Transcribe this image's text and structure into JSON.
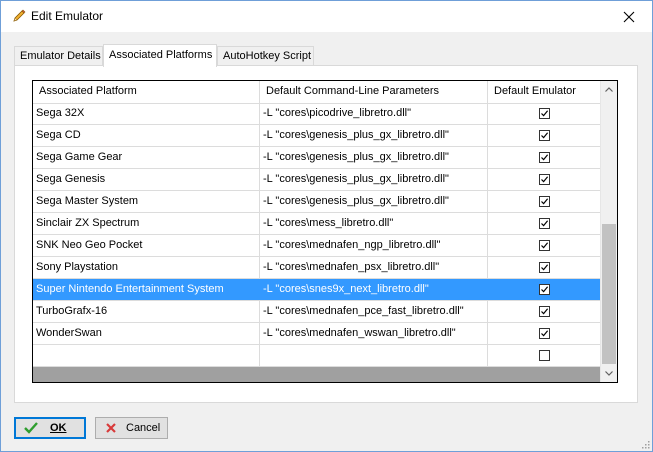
{
  "window": {
    "title": "Edit Emulator"
  },
  "tabs": [
    {
      "label": "Emulator Details"
    },
    {
      "label": "Associated Platforms"
    },
    {
      "label": "AutoHotkey Script"
    }
  ],
  "grid": {
    "columns": [
      "Associated Platform",
      "Default Command-Line Parameters",
      "Default Emulator"
    ],
    "rows": [
      {
        "platform": "Sega 32X",
        "params": "-L \"cores\\picodrive_libretro.dll\"",
        "default": true
      },
      {
        "platform": "Sega CD",
        "params": "-L \"cores\\genesis_plus_gx_libretro.dll\"",
        "default": true
      },
      {
        "platform": "Sega Game Gear",
        "params": "-L \"cores\\genesis_plus_gx_libretro.dll\"",
        "default": true
      },
      {
        "platform": "Sega Genesis",
        "params": "-L \"cores\\genesis_plus_gx_libretro.dll\"",
        "default": true
      },
      {
        "platform": "Sega Master System",
        "params": "-L \"cores\\genesis_plus_gx_libretro.dll\"",
        "default": true
      },
      {
        "platform": "Sinclair ZX Spectrum",
        "params": "-L \"cores\\mess_libretro.dll\"",
        "default": true
      },
      {
        "platform": "SNK Neo Geo Pocket",
        "params": "-L \"cores\\mednafen_ngp_libretro.dll\"",
        "default": true
      },
      {
        "platform": "Sony Playstation",
        "params": "-L \"cores\\mednafen_psx_libretro.dll\"",
        "default": true
      },
      {
        "platform": "Super Nintendo Entertainment System",
        "params": "-L \"cores\\snes9x_next_libretro.dll\"",
        "default": true
      },
      {
        "platform": "TurboGrafx-16",
        "params": "-L \"cores\\mednafen_pce_fast_libretro.dll\"",
        "default": true
      },
      {
        "platform": "WonderSwan",
        "params": "-L \"cores\\mednafen_wswan_libretro.dll\"",
        "default": true
      },
      {
        "platform": "",
        "params": "",
        "default": false
      }
    ],
    "selected_platform": "Super Nintendo Entertainment System"
  },
  "buttons": {
    "ok": "OK",
    "cancel": "Cancel"
  },
  "colors": {
    "selection": "#3399ff",
    "ok_border": "#0078d7"
  }
}
